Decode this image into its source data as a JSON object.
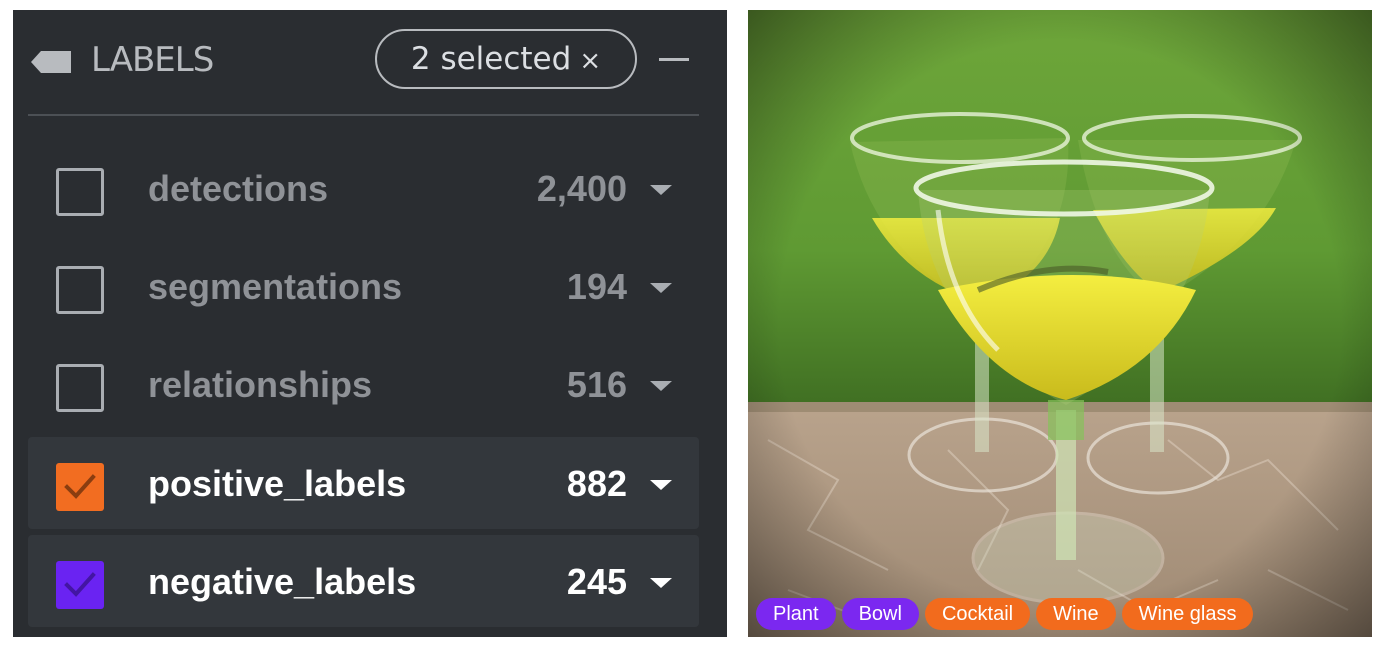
{
  "panel": {
    "icon": "tag-icon",
    "title": "LABELS",
    "selection_badge": {
      "text": "2 selected",
      "clear_symbol": "×"
    },
    "collapse_icon": "minus-icon",
    "fields": [
      {
        "name": "detections",
        "count": "2,400",
        "checked": false,
        "color": ""
      },
      {
        "name": "segmentations",
        "count": "194",
        "checked": false,
        "color": ""
      },
      {
        "name": "relationships",
        "count": "516",
        "checked": false,
        "color": ""
      },
      {
        "name": "positive_labels",
        "count": "882",
        "checked": true,
        "color": "#f26d21"
      },
      {
        "name": "negative_labels",
        "count": "245",
        "checked": true,
        "color": "#6a23f2"
      }
    ]
  },
  "image": {
    "description_icon": "photo-of-three-wine-glasses",
    "tags": [
      {
        "label": "Plant",
        "color": "#7b28f0"
      },
      {
        "label": "Bowl",
        "color": "#7b28f0"
      },
      {
        "label": "Cocktail",
        "color": "#f26b1d"
      },
      {
        "label": "Wine",
        "color": "#f26b1d"
      },
      {
        "label": "Wine glass",
        "color": "#f26b1d"
      }
    ]
  }
}
